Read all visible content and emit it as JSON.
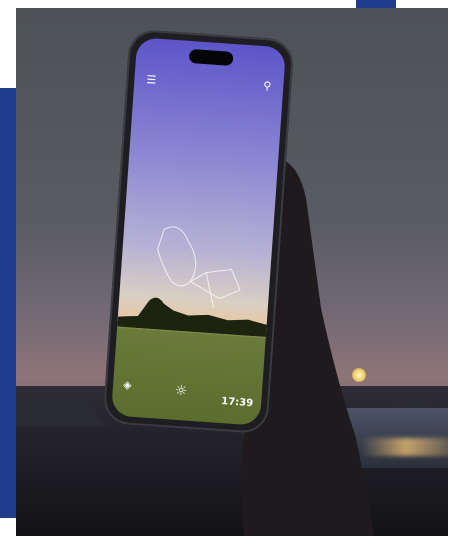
{
  "phone_screen": {
    "clock": "17:39",
    "icons": {
      "menu": "menu-icon",
      "search": "search-icon",
      "layers": "layers-icon",
      "settings": "settings-icon"
    }
  },
  "colors": {
    "frame_accent": "#1f3d8c",
    "sky_top": "#5c55c9",
    "sky_horizon": "#e9c79f",
    "grass": "#5b6d2e"
  }
}
